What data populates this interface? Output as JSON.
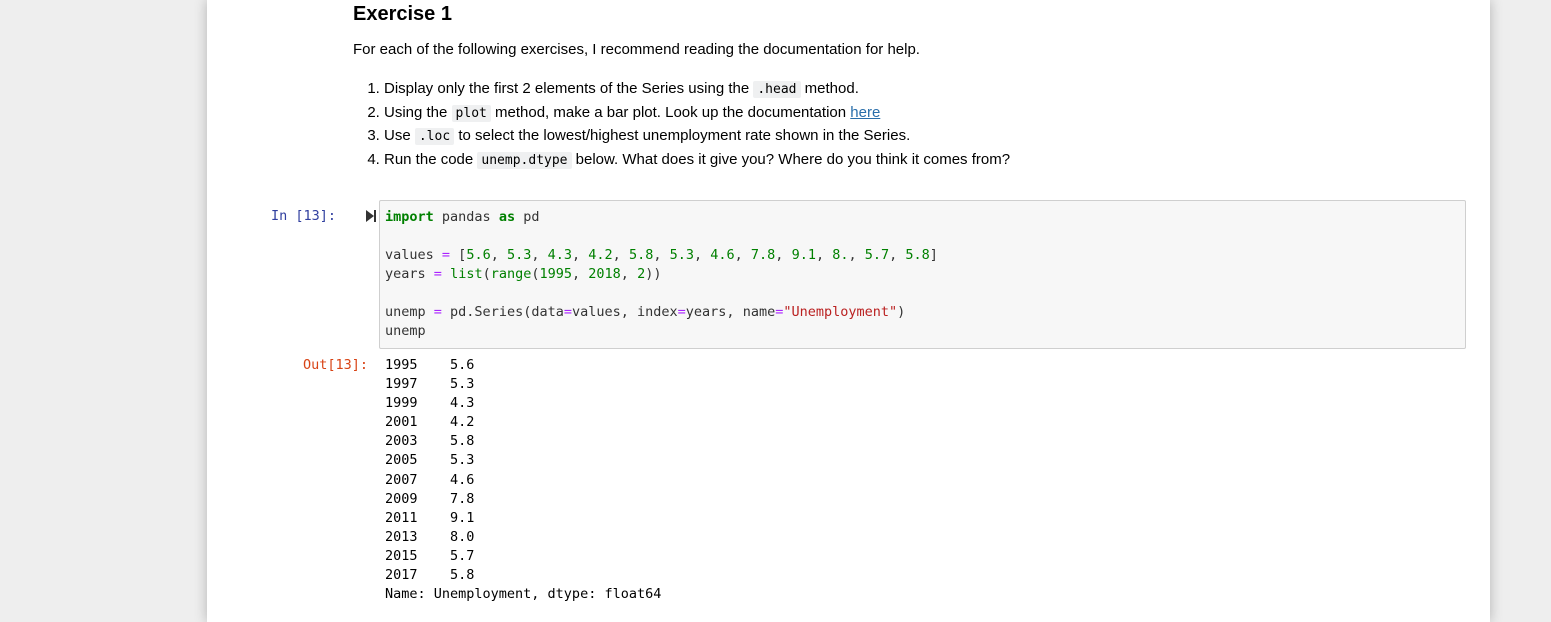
{
  "markdown": {
    "heading": "Exercise 1",
    "intro": "For each of the following exercises, I recommend reading the documentation for help.",
    "items": [
      {
        "pre": "Display only the first 2 elements of the Series using the ",
        "code": ".head",
        "post": " method."
      },
      {
        "pre": "Using the ",
        "code": "plot",
        "post": " method, make a bar plot. Look up the documentation ",
        "link": "here"
      },
      {
        "pre": "Use ",
        "code": ".loc",
        "post": " to select the lowest/highest unemployment rate shown in the Series."
      },
      {
        "pre": "Run the code ",
        "code": "unemp.dtype",
        "post": " below. What does it give you? Where do you think it comes from?"
      }
    ]
  },
  "cell": {
    "in_prompt": "In [13]:",
    "out_prompt": "Out[13]:",
    "run_icon": "run-cell-icon",
    "code_lines": [
      "import pandas as pd",
      "",
      "values = [5.6, 5.3, 4.3, 4.2, 5.8, 5.3, 4.6, 7.8, 9.1, 8., 5.7, 5.8]",
      "years = list(range(1995, 2018, 2))",
      "",
      "unemp = pd.Series(data=values, index=years, name=\"Unemployment\")",
      "unemp"
    ],
    "output": {
      "rows": [
        {
          "year": "1995",
          "value": "5.6"
        },
        {
          "year": "1997",
          "value": "5.3"
        },
        {
          "year": "1999",
          "value": "4.3"
        },
        {
          "year": "2001",
          "value": "4.2"
        },
        {
          "year": "2003",
          "value": "5.8"
        },
        {
          "year": "2005",
          "value": "5.3"
        },
        {
          "year": "2007",
          "value": "4.6"
        },
        {
          "year": "2009",
          "value": "7.8"
        },
        {
          "year": "2011",
          "value": "9.1"
        },
        {
          "year": "2013",
          "value": "8.0"
        },
        {
          "year": "2015",
          "value": "5.7"
        },
        {
          "year": "2017",
          "value": "5.8"
        }
      ],
      "footer": "Name: Unemployment, dtype: float64"
    }
  },
  "colors": {
    "in_prompt": "#303f9f",
    "out_prompt": "#d84315",
    "keyword": "#008000",
    "operator": "#aa22ff",
    "string": "#ba2121",
    "link": "#296eaa"
  }
}
